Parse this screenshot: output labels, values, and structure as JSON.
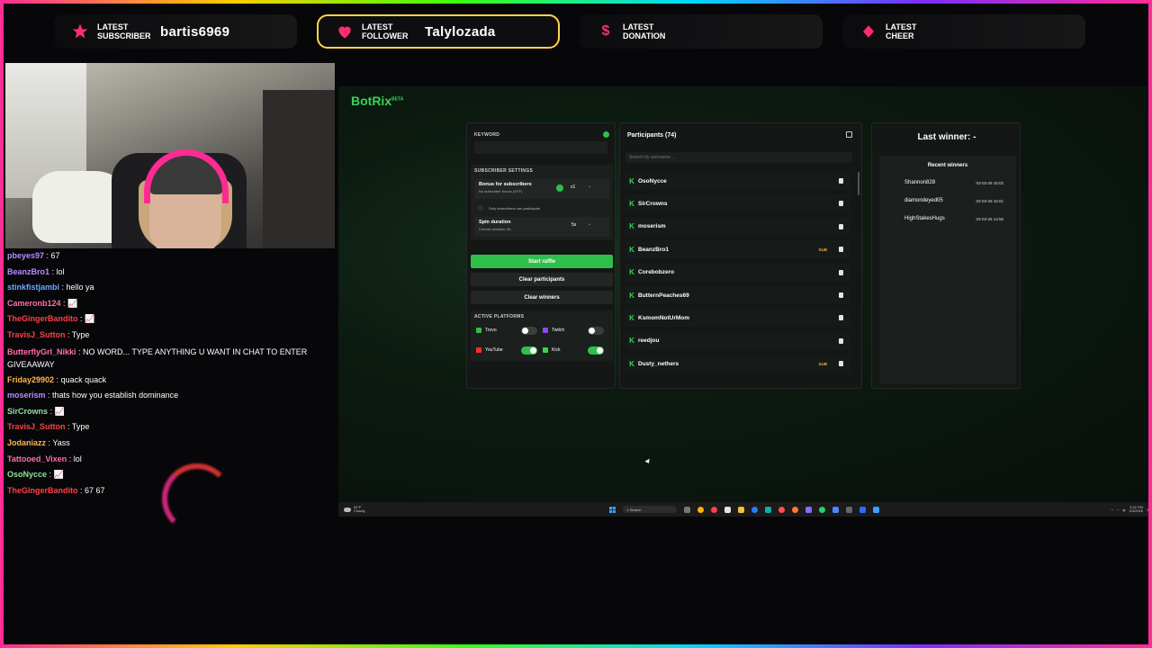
{
  "alerts": [
    {
      "label_line1": "LATEST",
      "label_line2": "SUBSCRIBER",
      "value": "bartis6969",
      "icon": "star-icon",
      "active": false
    },
    {
      "label_line1": "LATEST",
      "label_line2": "FOLLOWER",
      "value": "Talylozada",
      "icon": "heart-icon",
      "active": true
    },
    {
      "label_line1": "LATEST",
      "label_line2": "DONATION",
      "value": "",
      "icon": "dollar-icon",
      "active": false
    },
    {
      "label_line1": "LATEST",
      "label_line2": "CHEER",
      "value": "",
      "icon": "diamond-icon",
      "active": false
    }
  ],
  "chat": [
    {
      "user": "pbeyes97",
      "color": "#b88cff",
      "text": ": 67"
    },
    {
      "user": "BeanzBro1",
      "color": "#b88cff",
      "text": ": lol"
    },
    {
      "user": "stinkfistjambi",
      "color": "#6aa8ff",
      "text": ": hello ya"
    },
    {
      "user": "Cameronb124",
      "color": "#ff6fa5",
      "text": ": 📈"
    },
    {
      "user": "TheGingerBandito",
      "color": "#ff4040",
      "text": ": 📈"
    },
    {
      "user": "TravisJ_Sutton",
      "color": "#ff4040",
      "text": ": Type"
    },
    {
      "user": "ButterflyGrl_Nikki",
      "color": "#ff6fa5",
      "text": ": NO WORD... TYPE ANYTHING U WANT IN CHAT TO ENTER GIVEAAWAY"
    },
    {
      "user": "Friday29902",
      "color": "#ffb84a",
      "text": ": quack quack"
    },
    {
      "user": "moserism",
      "color": "#b88cff",
      "text": ": thats how you establish dominance"
    },
    {
      "user": "SirCrowns",
      "color": "#8fe39b",
      "text": ": 📈"
    },
    {
      "user": "TravisJ_Sutton",
      "color": "#ff4040",
      "text": ": Type"
    },
    {
      "user": "Jodaniazz",
      "color": "#ffb84a",
      "text": ": Yass"
    },
    {
      "user": "Tattooed_Vixen",
      "color": "#ff6fa5",
      "text": ": lol"
    },
    {
      "user": "OsoNycce",
      "color": "#8fe39b",
      "text": ": 📈"
    },
    {
      "user": "TheGingerBandito",
      "color": "#ff4040",
      "text": ": 67 67"
    }
  ],
  "app": {
    "logo": "BotRix",
    "logo_tag": "BETA",
    "keyword_label": "KEYWORD",
    "subscriber_settings_label": "SUBSCRIBER SETTINGS",
    "bonus_title": "Bonus for subscribers",
    "bonus_sub": "No subscriber bonus (OFF)",
    "bonus_value": "x1",
    "only_subs_label": "Only subscribers can participate",
    "spin_title": "Spin duration",
    "spin_sub": "Current duration: 5s",
    "spin_value": "5s",
    "start_btn": "Start raffle",
    "clear_participants_btn": "Clear participants",
    "clear_winners_btn": "Clear winners",
    "platforms_label": "ACTIVE PLATFORMS",
    "platforms": [
      {
        "name": "Trovo",
        "on": false
      },
      {
        "name": "Twitch",
        "on": false
      },
      {
        "name": "YouTube",
        "on": true
      },
      {
        "name": "Kick",
        "on": true
      }
    ],
    "participants_title": "Participants (74)",
    "search_placeholder": "Search by username...",
    "participants": [
      {
        "name": "OsoNycce",
        "sub": false
      },
      {
        "name": "SirCrowns",
        "sub": false
      },
      {
        "name": "moserism",
        "sub": false
      },
      {
        "name": "BeanzBro1",
        "sub": true
      },
      {
        "name": "Corebobzero",
        "sub": false
      },
      {
        "name": "ButternPeaches69",
        "sub": false
      },
      {
        "name": "KsmomNotUrMom",
        "sub": false
      },
      {
        "name": "reedjou",
        "sub": false
      },
      {
        "name": "Dusty_nethers",
        "sub": true
      }
    ],
    "sub_badge": "SUB",
    "last_winner": "Last winner: -",
    "recent_winners_label": "Recent winners",
    "winners": [
      {
        "name": "Shannon828",
        "date": "03-03-26 15:02"
      },
      {
        "name": "diamondeyed05",
        "date": "03-03-26 15:01"
      },
      {
        "name": "HighStakesHugs",
        "date": "03-03-26 14:56"
      }
    ]
  },
  "taskbar": {
    "weather_temp": "61°F",
    "weather_text": "Cloudy",
    "search": "Search",
    "time": "3:02 PM",
    "date": "3/3/2026"
  }
}
